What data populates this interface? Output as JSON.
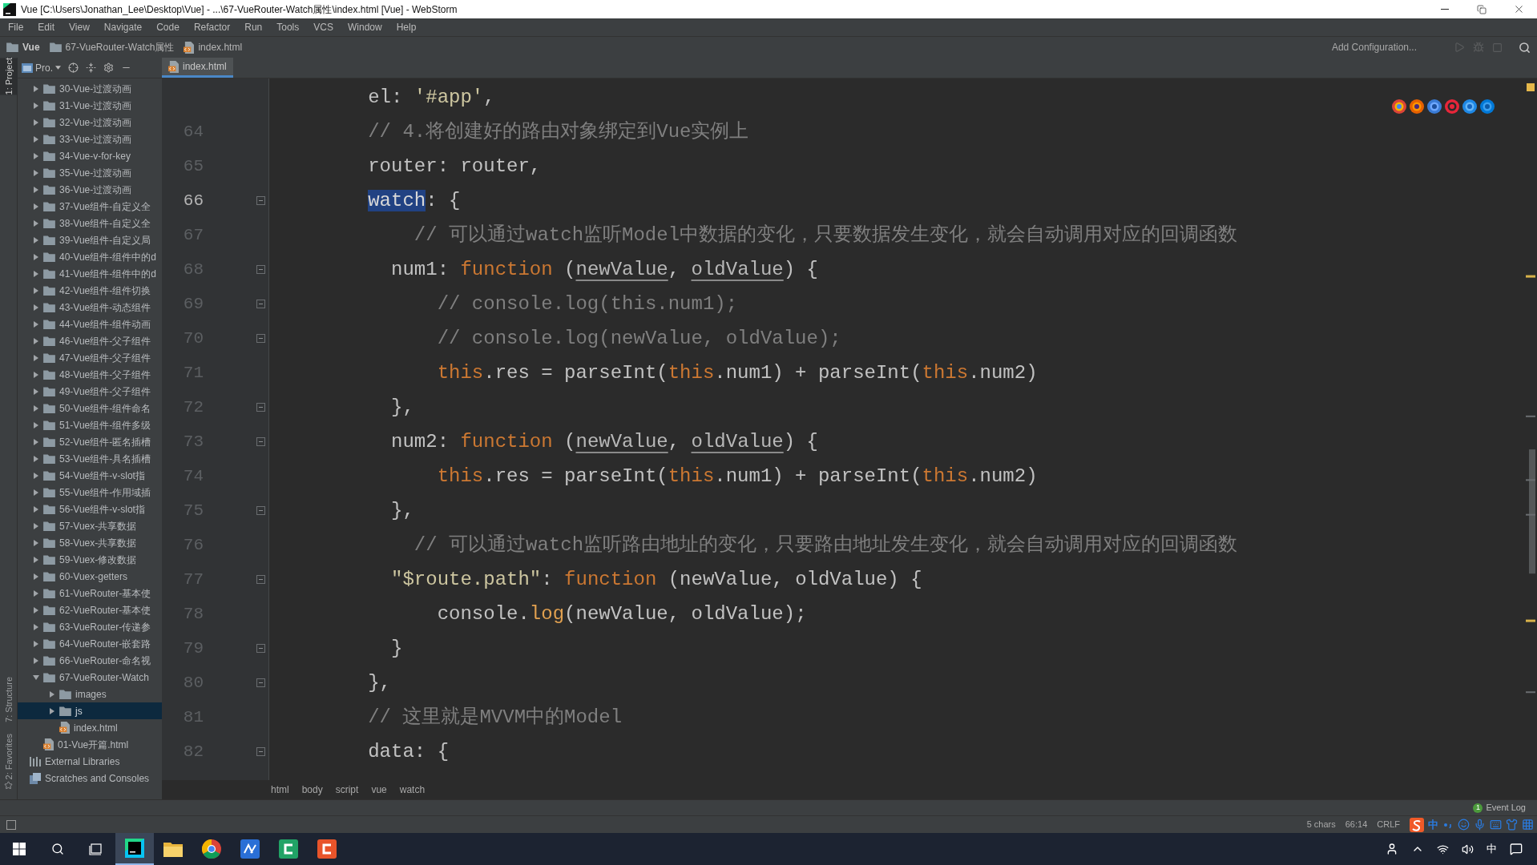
{
  "window": {
    "title": "Vue [C:\\Users\\Jonathan_Lee\\Desktop\\Vue] - ...\\67-VueRouter-Watch属性\\index.html [Vue] - WebStorm"
  },
  "menu": [
    "File",
    "Edit",
    "View",
    "Navigate",
    "Code",
    "Refactor",
    "Run",
    "Tools",
    "VCS",
    "Window",
    "Help"
  ],
  "navigation_bar": {
    "breadcrumbs": [
      {
        "label": "Vue",
        "kind": "project"
      },
      {
        "label": "67-VueRouter-Watch属性",
        "kind": "folder"
      },
      {
        "label": "index.html",
        "kind": "html"
      }
    ],
    "run_configuration": "Add Configuration..."
  },
  "tool_strip": {
    "top": [
      {
        "label": "1: Project",
        "selected": true
      }
    ],
    "bottom": [
      {
        "label": "7: Structure",
        "selected": false
      },
      {
        "label": "2: Favorites",
        "selected": false
      }
    ]
  },
  "project_panel": {
    "title": "Pro.",
    "tree": {
      "items": [
        {
          "label": "30-Vue-过渡动画",
          "kind": "folder",
          "expanded": false,
          "selected": false
        },
        {
          "label": "31-Vue-过渡动画",
          "kind": "folder",
          "expanded": false,
          "selected": false
        },
        {
          "label": "32-Vue-过渡动画",
          "kind": "folder",
          "expanded": false,
          "selected": false
        },
        {
          "label": "33-Vue-过渡动画",
          "kind": "folder",
          "expanded": false,
          "selected": false
        },
        {
          "label": "34-Vue-v-for-key",
          "kind": "folder",
          "expanded": false,
          "selected": false
        },
        {
          "label": "35-Vue-过渡动画",
          "kind": "folder",
          "expanded": false,
          "selected": false
        },
        {
          "label": "36-Vue-过渡动画",
          "kind": "folder",
          "expanded": false,
          "selected": false
        },
        {
          "label": "37-Vue组件-自定义全",
          "kind": "folder",
          "expanded": false,
          "selected": false
        },
        {
          "label": "38-Vue组件-自定义全",
          "kind": "folder",
          "expanded": false,
          "selected": false
        },
        {
          "label": "39-Vue组件-自定义局",
          "kind": "folder",
          "expanded": false,
          "selected": false
        },
        {
          "label": "40-Vue组件-组件中的d",
          "kind": "folder",
          "expanded": false,
          "selected": false
        },
        {
          "label": "41-Vue组件-组件中的d",
          "kind": "folder",
          "expanded": false,
          "selected": false
        },
        {
          "label": "42-Vue组件-组件切换",
          "kind": "folder",
          "expanded": false,
          "selected": false
        },
        {
          "label": "43-Vue组件-动态组件",
          "kind": "folder",
          "expanded": false,
          "selected": false
        },
        {
          "label": "44-Vue组件-组件动画",
          "kind": "folder",
          "expanded": false,
          "selected": false
        },
        {
          "label": "46-Vue组件-父子组件",
          "kind": "folder",
          "expanded": false,
          "selected": false
        },
        {
          "label": "47-Vue组件-父子组件",
          "kind": "folder",
          "expanded": false,
          "selected": false
        },
        {
          "label": "48-Vue组件-父子组件",
          "kind": "folder",
          "expanded": false,
          "selected": false
        },
        {
          "label": "49-Vue组件-父子组件",
          "kind": "folder",
          "expanded": false,
          "selected": false
        },
        {
          "label": "50-Vue组件-组件命名",
          "kind": "folder",
          "expanded": false,
          "selected": false
        },
        {
          "label": "51-Vue组件-组件多级",
          "kind": "folder",
          "expanded": false,
          "selected": false
        },
        {
          "label": "52-Vue组件-匿名插槽",
          "kind": "folder",
          "expanded": false,
          "selected": false
        },
        {
          "label": "53-Vue组件-具名插槽",
          "kind": "folder",
          "expanded": false,
          "selected": false
        },
        {
          "label": "54-Vue组件-v-slot指",
          "kind": "folder",
          "expanded": false,
          "selected": false
        },
        {
          "label": "55-Vue组件-作用域插",
          "kind": "folder",
          "expanded": false,
          "selected": false
        },
        {
          "label": "56-Vue组件-v-slot指",
          "kind": "folder",
          "expanded": false,
          "selected": false
        },
        {
          "label": "57-Vuex-共享数据",
          "kind": "folder",
          "expanded": false,
          "selected": false
        },
        {
          "label": "58-Vuex-共享数据",
          "kind": "folder",
          "expanded": false,
          "selected": false
        },
        {
          "label": "59-Vuex-修改数据",
          "kind": "folder",
          "expanded": false,
          "selected": false
        },
        {
          "label": "60-Vuex-getters",
          "kind": "folder",
          "expanded": false,
          "selected": false
        },
        {
          "label": "61-VueRouter-基本使",
          "kind": "folder",
          "expanded": false,
          "selected": false
        },
        {
          "label": "62-VueRouter-基本使",
          "kind": "folder",
          "expanded": false,
          "selected": false
        },
        {
          "label": "63-VueRouter-传递参",
          "kind": "folder",
          "expanded": false,
          "selected": false
        },
        {
          "label": "64-VueRouter-嵌套路",
          "kind": "folder",
          "expanded": false,
          "selected": false
        },
        {
          "label": "66-VueRouter-命名视",
          "kind": "folder",
          "expanded": false,
          "selected": false
        },
        {
          "label": "67-VueRouter-Watch",
          "kind": "folder",
          "expanded": true,
          "selected": false,
          "children": [
            {
              "label": "images",
              "kind": "folder",
              "expanded": false,
              "selected": false
            },
            {
              "label": "js",
              "kind": "folder",
              "expanded": false,
              "selected": true
            },
            {
              "label": "index.html",
              "kind": "html",
              "selected": false
            }
          ]
        },
        {
          "label": "01-Vue开篇.html",
          "kind": "html",
          "selected": false
        }
      ],
      "root_items": [
        {
          "label": "External Libraries",
          "kind": "library",
          "selected": false
        },
        {
          "label": "Scratches and Consoles",
          "kind": "scratches",
          "selected": false
        }
      ]
    }
  },
  "editor": {
    "tabs": [
      {
        "label": "index.html",
        "selected": true
      }
    ],
    "lines": [
      {
        "fold": false,
        "tokens": [
          {
            "text": "        el: ",
            "kind": "plain"
          },
          {
            "text": "'#app'",
            "kind": "string"
          },
          {
            "text": ",",
            "kind": "plain"
          }
        ]
      },
      {
        "number": "64",
        "current": false,
        "fold": false,
        "tokens": [
          {
            "text": "        // 4.将创建好的路由对象绑定到Vue实例上",
            "kind": "comment"
          }
        ]
      },
      {
        "number": "65",
        "current": false,
        "fold": false,
        "tokens": [
          {
            "text": "        router: router,",
            "kind": "plain"
          }
        ]
      },
      {
        "number": "66",
        "current": true,
        "fold": true,
        "tokens": [
          {
            "text": "        watch",
            "kind": "selection"
          },
          {
            "text": ": {",
            "kind": "plain"
          }
        ]
      },
      {
        "number": "67",
        "current": false,
        "fold": false,
        "tokens": [
          {
            "text": "            // 可以通过watch监听Model中数据的变化，只要数据发生变化，就会自动调用对应的回调函数",
            "kind": "comment"
          }
        ]
      },
      {
        "number": "68",
        "current": false,
        "fold": true,
        "tokens": [
          {
            "text": "          num1: ",
            "kind": "plain"
          },
          {
            "text": "function",
            "kind": "keyword"
          },
          {
            "text": " (",
            "kind": "plain"
          },
          {
            "text": "newValue",
            "kind": "unused"
          },
          {
            "text": ", ",
            "kind": "plain"
          },
          {
            "text": "oldValue",
            "kind": "unused"
          },
          {
            "text": ") {",
            "kind": "plain"
          }
        ]
      },
      {
        "number": "69",
        "current": false,
        "fold": true,
        "tokens": [
          {
            "text": "              // console.log(this.num1);",
            "kind": "comment"
          }
        ]
      },
      {
        "number": "70",
        "current": false,
        "fold": true,
        "tokens": [
          {
            "text": "              // console.log(newValue, oldValue);",
            "kind": "comment"
          }
        ]
      },
      {
        "number": "71",
        "current": false,
        "fold": false,
        "tokens": [
          {
            "text": "              this",
            "kind": "keyword"
          },
          {
            "text": ".res = parseInt(",
            "kind": "plain"
          },
          {
            "text": "this",
            "kind": "keyword"
          },
          {
            "text": ".num1) + parseInt(",
            "kind": "plain"
          },
          {
            "text": "this",
            "kind": "keyword"
          },
          {
            "text": ".num2)",
            "kind": "plain"
          }
        ]
      },
      {
        "number": "72",
        "current": false,
        "fold": true,
        "tokens": [
          {
            "text": "          },",
            "kind": "plain"
          }
        ]
      },
      {
        "number": "73",
        "current": false,
        "fold": true,
        "tokens": [
          {
            "text": "          num2: ",
            "kind": "plain"
          },
          {
            "text": "function",
            "kind": "keyword"
          },
          {
            "text": " (",
            "kind": "plain"
          },
          {
            "text": "newValue",
            "kind": "unused"
          },
          {
            "text": ", ",
            "kind": "plain"
          },
          {
            "text": "oldValue",
            "kind": "unused"
          },
          {
            "text": ") {",
            "kind": "plain"
          }
        ]
      },
      {
        "number": "74",
        "current": false,
        "fold": false,
        "tokens": [
          {
            "text": "              this",
            "kind": "keyword"
          },
          {
            "text": ".res = parseInt(",
            "kind": "plain"
          },
          {
            "text": "this",
            "kind": "keyword"
          },
          {
            "text": ".num1) + parseInt(",
            "kind": "plain"
          },
          {
            "text": "this",
            "kind": "keyword"
          },
          {
            "text": ".num2)",
            "kind": "plain"
          }
        ]
      },
      {
        "number": "75",
        "current": false,
        "fold": true,
        "tokens": [
          {
            "text": "          },",
            "kind": "plain"
          }
        ]
      },
      {
        "number": "76",
        "current": false,
        "fold": false,
        "tokens": [
          {
            "text": "            // 可以通过watch监听路由地址的变化，只要路由地址发生变化，就会自动调用对应的回调函数",
            "kind": "comment"
          }
        ]
      },
      {
        "number": "77",
        "current": false,
        "fold": true,
        "tokens": [
          {
            "text": "          \"$route.path\"",
            "kind": "string"
          },
          {
            "text": ": ",
            "kind": "plain"
          },
          {
            "text": "function",
            "kind": "keyword"
          },
          {
            "text": " (newValue, oldValue) {",
            "kind": "plain"
          }
        ]
      },
      {
        "number": "78",
        "current": false,
        "fold": false,
        "tokens": [
          {
            "text": "              console.",
            "kind": "plain"
          },
          {
            "text": "log",
            "kind": "method"
          },
          {
            "text": "(newValue, oldValue);",
            "kind": "plain"
          }
        ]
      },
      {
        "number": "79",
        "current": false,
        "fold": true,
        "tokens": [
          {
            "text": "          }",
            "kind": "plain"
          }
        ]
      },
      {
        "number": "80",
        "current": false,
        "fold": true,
        "tokens": [
          {
            "text": "        },",
            "kind": "plain"
          }
        ]
      },
      {
        "number": "81",
        "current": false,
        "fold": false,
        "tokens": [
          {
            "text": "        // 这里就是MVVM中的Model",
            "kind": "comment"
          }
        ]
      },
      {
        "number": "82",
        "current": false,
        "fold": true,
        "tokens": [
          {
            "text": "        data: {",
            "kind": "plain"
          }
        ]
      }
    ],
    "breadcrumbs": [
      "html",
      "body",
      "script",
      "vue",
      "watch"
    ]
  },
  "tool_windows": {
    "event_log": {
      "label": "Event Log",
      "count": "1"
    }
  },
  "status_bar": {
    "items": [
      "5 chars",
      "66:14",
      "CRLF"
    ],
    "ime_mode": "中"
  },
  "taskbar": {
    "apps": [
      {
        "kind": "ide",
        "active": true
      },
      {
        "kind": "folder",
        "active": false
      },
      {
        "kind": "browser",
        "active": false
      },
      {
        "kind": "zigzag",
        "active": false
      },
      {
        "kind": "bracket",
        "active": false
      },
      {
        "kind": "bracketalt",
        "active": false
      }
    ],
    "tray_ime": "中"
  }
}
